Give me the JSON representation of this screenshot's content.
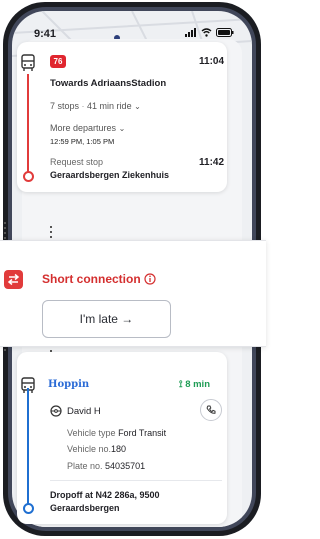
{
  "status_bar": {
    "time": "9:41"
  },
  "trip": {
    "line_badge": "76",
    "departure_time": "11:04",
    "direction": "Towards AdriaansStadion",
    "stops": "7 stops",
    "ride": "41 min ride",
    "more_departures_label": "More departures",
    "more_departures_times": "12:59 PM, 1:05 PM",
    "request_stop_label": "Request stop",
    "arrival_time": "11:42",
    "arrival_stop": "Geraardsbergen Ziekenhuis"
  },
  "connection": {
    "label": "Short connection",
    "late_button": "I'm late →"
  },
  "ride": {
    "provider": "Hoppin",
    "eta": "8 min",
    "driver": "David H",
    "vehicle_type_label": "Vehicle type",
    "vehicle_type": "Ford Transit",
    "vehicle_no_label": "Vehicle no.",
    "vehicle_no": "180",
    "plate_label": "Plate no.",
    "plate": "54035701",
    "dropoff_line1": "Dropoff at N42 286a, 9500",
    "dropoff_line2": "Geraardsbergen"
  },
  "colors": {
    "accent_red": "#e13b3b",
    "accent_blue": "#1f6fd1",
    "eta_green": "#1f9d55"
  }
}
